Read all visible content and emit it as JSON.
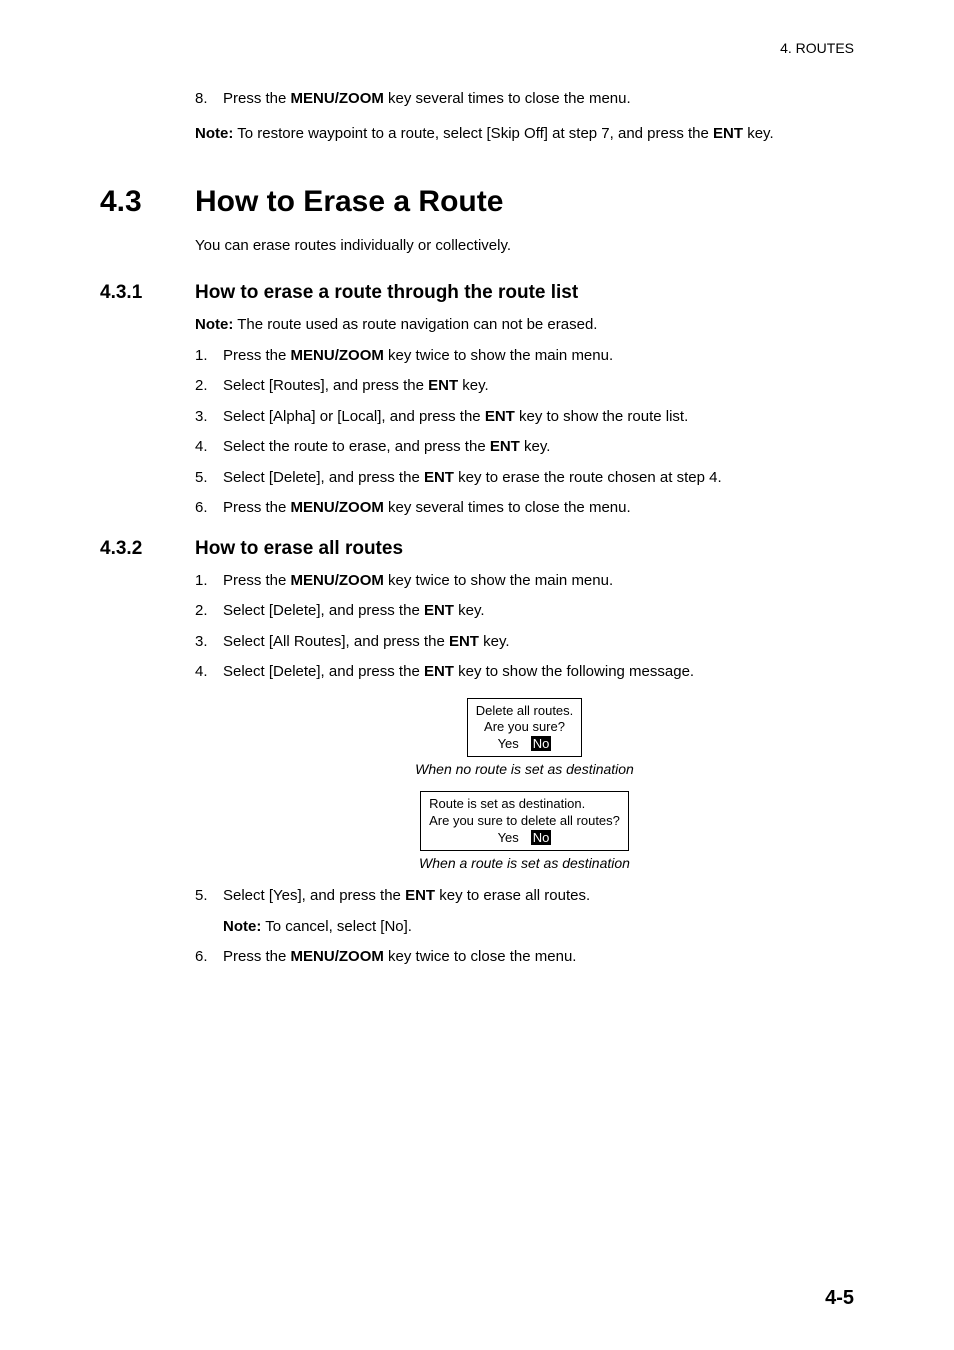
{
  "header": "4.  ROUTES",
  "intro": {
    "step8_num": "8.",
    "step8_pre": "Press the ",
    "step8_k": "MENU/ZOOM",
    "step8_post": " key several times to close the menu.",
    "note_label": "Note:",
    "note_body_a": " To restore waypoint to a route, select [Skip Off] at step 7, and press the ",
    "note_k": "ENT",
    "note_body_b": " key."
  },
  "sec": {
    "num": "4.3",
    "title": "How to Erase a Route",
    "lead": "You can erase routes individually or collectively."
  },
  "s431": {
    "num": "4.3.1",
    "title": "How to erase a route through the route list",
    "note_label": "Note:",
    "note_body": " The route used as route navigation can not be erased.",
    "st1n": "1.",
    "st1a": "Press the ",
    "st1k": "MENU/ZOOM",
    "st1b": " key twice to show the main menu.",
    "st2n": "2.",
    "st2a": "Select [Routes], and press the ",
    "st2k": "ENT",
    "st2b": " key.",
    "st3n": "3.",
    "st3a": "Select [Alpha] or [Local], and press the ",
    "st3k": "ENT",
    "st3b": " key to show the route list.",
    "st4n": "4.",
    "st4a": "Select the route to erase, and press the ",
    "st4k": "ENT",
    "st4b": " key.",
    "st5n": "5.",
    "st5a": "Select [Delete], and press the ",
    "st5k": "ENT",
    "st5b": " key to erase the route chosen at step 4.",
    "st6n": "6.",
    "st6a": "Press the ",
    "st6k": "MENU/ZOOM",
    "st6b": " key several times to close the menu."
  },
  "s432": {
    "num": "4.3.2",
    "title": "How to erase all routes",
    "st1n": "1.",
    "st1a": "Press the ",
    "st1k": "MENU/ZOOM",
    "st1b": " key twice to show the main menu.",
    "st2n": "2.",
    "st2a": "Select [Delete], and press the ",
    "st2k": "ENT",
    "st2b": " key.",
    "st3n": "3.",
    "st3a": "Select [All Routes], and press the ",
    "st3k": "ENT",
    "st3b": " key.",
    "st4n": "4.",
    "st4a": "Select [Delete], and press the ",
    "st4k": "ENT",
    "st4b": " key to show the following message.",
    "dlg1_l1": "Delete all routes.",
    "dlg1_l2": "Are you sure?",
    "dlg_yes": "Yes",
    "dlg_no": "No",
    "cap1": "When no route is set as destination",
    "dlg2_l1": "Route is set as destination.",
    "dlg2_l2": "Are you sure to delete all routes?",
    "cap2": "When a route is set as destination",
    "st5n": "5.",
    "st5a": "Select [Yes], and press the ",
    "st5k": "ENT",
    "st5b": " key to erase all routes.",
    "st5_note_label": "Note:",
    "st5_note_body": " To cancel, select [No].",
    "st6n": "6.",
    "st6a": "Press the ",
    "st6k": "MENU/ZOOM",
    "st6b": " key twice to close the menu."
  },
  "footer": "4-5"
}
